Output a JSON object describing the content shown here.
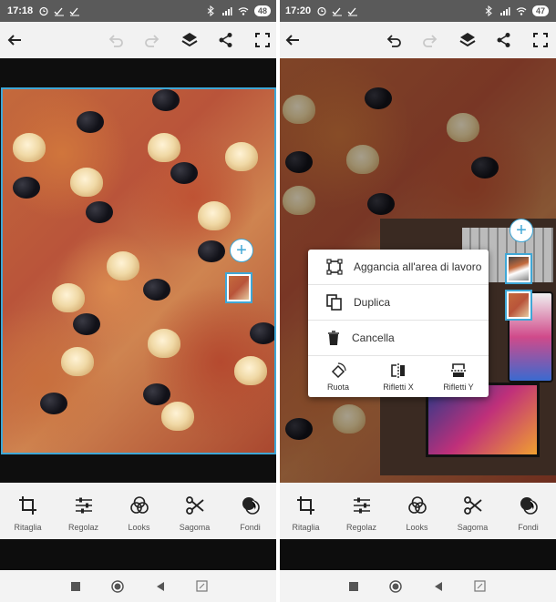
{
  "left_phone": {
    "status": {
      "time": "17:18",
      "battery": "48"
    },
    "tools": [
      {
        "label": "Ritaglia",
        "icon": "crop-icon"
      },
      {
        "label": "Regolaz",
        "icon": "adjust-icon"
      },
      {
        "label": "Looks",
        "icon": "looks-icon"
      },
      {
        "label": "Sagoma",
        "icon": "scissors-icon"
      },
      {
        "label": "Fondi",
        "icon": "blend-icon"
      }
    ]
  },
  "right_phone": {
    "status": {
      "time": "17:20",
      "battery": "47"
    },
    "context_menu": {
      "items": [
        {
          "label": "Aggancia all'area di lavoro",
          "icon": "fit-frame-icon"
        },
        {
          "label": "Duplica",
          "icon": "duplicate-icon"
        },
        {
          "label": "Cancella",
          "icon": "trash-icon"
        }
      ],
      "actions": [
        {
          "label": "Ruota",
          "icon": "rotate-icon"
        },
        {
          "label": "Rifletti X",
          "icon": "flip-x-icon"
        },
        {
          "label": "Rifletti Y",
          "icon": "flip-y-icon"
        }
      ]
    },
    "tools": [
      {
        "label": "Ritaglia",
        "icon": "crop-icon"
      },
      {
        "label": "Regolaz",
        "icon": "adjust-icon"
      },
      {
        "label": "Looks",
        "icon": "looks-icon"
      },
      {
        "label": "Sagoma",
        "icon": "scissors-icon"
      },
      {
        "label": "Fondi",
        "icon": "blend-icon"
      }
    ]
  },
  "colors": {
    "accent": "#3fa7d6",
    "toolbar": "#f2f2f2",
    "statusbar": "#5a5a5a"
  }
}
